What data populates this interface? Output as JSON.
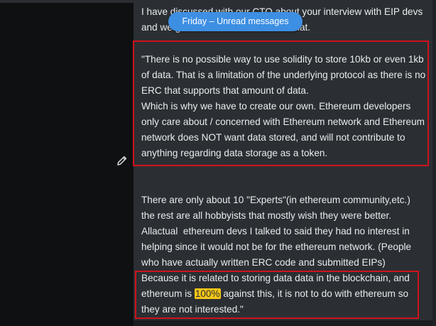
{
  "unread_pill": {
    "label": "Friday – Unread messages"
  },
  "message": {
    "intro_text": "I have discussed with our CTO about your interview with EIP devs and we got a lot of feedback about that.",
    "quote_block_1": "\"There is no possible way to use solidity to store 10kb or even 1kb of data. That is a limitation of the underlying protocol as there is no ERC that supports that amount of data.\nWhich is why we have to create our own. Ethereum developers only care about / concerned with Ethereum network and Ethereum network does NOT want data stored, and will not contribute to anything regarding data storage as a token.",
    "experts_block": "There are only about 10 \"Experts\"(in ethereum community,etc.) the rest are all hobbyists that mostly wish they were better. Allactual  ethereum devs I talked to said they had no interest in helping since it would not be for the ethereum network. (People who have actually written ERC code and submitted EIPs)",
    "quote_block_2_before": "Because it is related to storing data data in the blockchain, and ethereum is ",
    "quote_block_2_highlight": "100%",
    "quote_block_2_after": " against this, it is not to do with ethereum so they are not interested.\""
  },
  "colors": {
    "pill_blue": "#3d8fe3",
    "annotation_red": "#d0121b",
    "highlight_yellow": "#f5c518",
    "bubble_bg": "#2b2f33"
  },
  "icons": {
    "edit": "pencil-icon"
  }
}
